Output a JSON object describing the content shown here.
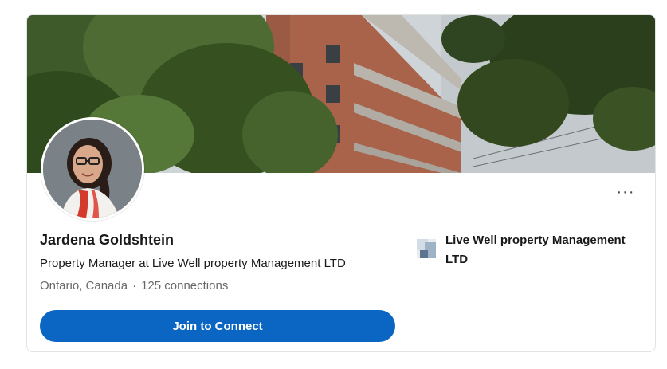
{
  "profile": {
    "name": "Jardena Goldshtein",
    "headline": "Property Manager at Live Well property Management LTD",
    "location": "Ontario, Canada",
    "separator": "·",
    "connections": "125 connections"
  },
  "actions": {
    "join_label": "Join to Connect",
    "more_label": "···"
  },
  "company": {
    "name": "Live Well property Management LTD"
  },
  "colors": {
    "primary": "#0a66c2",
    "secondary_text": "#666666"
  },
  "icons": {
    "more": "more-horizontal-icon",
    "company_logo": "company-logo-placeholder-icon"
  }
}
